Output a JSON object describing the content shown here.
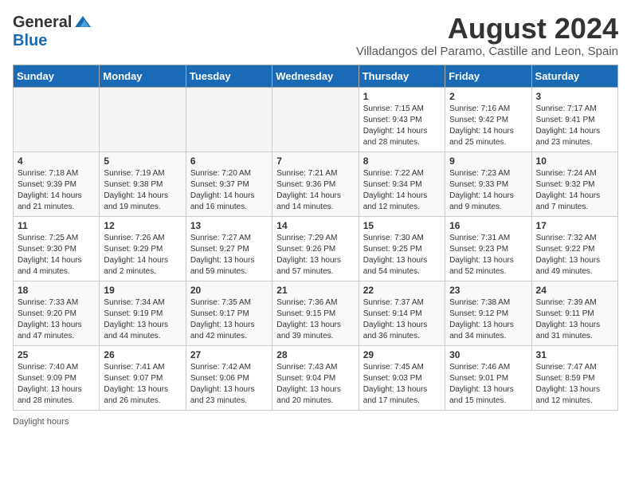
{
  "header": {
    "logo_general": "General",
    "logo_blue": "Blue",
    "month_title": "August 2024",
    "location": "Villadangos del Paramo, Castille and Leon, Spain"
  },
  "days_of_week": [
    "Sunday",
    "Monday",
    "Tuesday",
    "Wednesday",
    "Thursday",
    "Friday",
    "Saturday"
  ],
  "weeks": [
    [
      {
        "day": "",
        "empty": true
      },
      {
        "day": "",
        "empty": true
      },
      {
        "day": "",
        "empty": true
      },
      {
        "day": "",
        "empty": true
      },
      {
        "day": "1",
        "sunrise": "7:15 AM",
        "sunset": "9:43 PM",
        "daylight": "14 hours and 28 minutes."
      },
      {
        "day": "2",
        "sunrise": "7:16 AM",
        "sunset": "9:42 PM",
        "daylight": "14 hours and 25 minutes."
      },
      {
        "day": "3",
        "sunrise": "7:17 AM",
        "sunset": "9:41 PM",
        "daylight": "14 hours and 23 minutes."
      }
    ],
    [
      {
        "day": "4",
        "sunrise": "7:18 AM",
        "sunset": "9:39 PM",
        "daylight": "14 hours and 21 minutes."
      },
      {
        "day": "5",
        "sunrise": "7:19 AM",
        "sunset": "9:38 PM",
        "daylight": "14 hours and 19 minutes."
      },
      {
        "day": "6",
        "sunrise": "7:20 AM",
        "sunset": "9:37 PM",
        "daylight": "14 hours and 16 minutes."
      },
      {
        "day": "7",
        "sunrise": "7:21 AM",
        "sunset": "9:36 PM",
        "daylight": "14 hours and 14 minutes."
      },
      {
        "day": "8",
        "sunrise": "7:22 AM",
        "sunset": "9:34 PM",
        "daylight": "14 hours and 12 minutes."
      },
      {
        "day": "9",
        "sunrise": "7:23 AM",
        "sunset": "9:33 PM",
        "daylight": "14 hours and 9 minutes."
      },
      {
        "day": "10",
        "sunrise": "7:24 AM",
        "sunset": "9:32 PM",
        "daylight": "14 hours and 7 minutes."
      }
    ],
    [
      {
        "day": "11",
        "sunrise": "7:25 AM",
        "sunset": "9:30 PM",
        "daylight": "14 hours and 4 minutes."
      },
      {
        "day": "12",
        "sunrise": "7:26 AM",
        "sunset": "9:29 PM",
        "daylight": "14 hours and 2 minutes."
      },
      {
        "day": "13",
        "sunrise": "7:27 AM",
        "sunset": "9:27 PM",
        "daylight": "13 hours and 59 minutes."
      },
      {
        "day": "14",
        "sunrise": "7:29 AM",
        "sunset": "9:26 PM",
        "daylight": "13 hours and 57 minutes."
      },
      {
        "day": "15",
        "sunrise": "7:30 AM",
        "sunset": "9:25 PM",
        "daylight": "13 hours and 54 minutes."
      },
      {
        "day": "16",
        "sunrise": "7:31 AM",
        "sunset": "9:23 PM",
        "daylight": "13 hours and 52 minutes."
      },
      {
        "day": "17",
        "sunrise": "7:32 AM",
        "sunset": "9:22 PM",
        "daylight": "13 hours and 49 minutes."
      }
    ],
    [
      {
        "day": "18",
        "sunrise": "7:33 AM",
        "sunset": "9:20 PM",
        "daylight": "13 hours and 47 minutes."
      },
      {
        "day": "19",
        "sunrise": "7:34 AM",
        "sunset": "9:19 PM",
        "daylight": "13 hours and 44 minutes."
      },
      {
        "day": "20",
        "sunrise": "7:35 AM",
        "sunset": "9:17 PM",
        "daylight": "13 hours and 42 minutes."
      },
      {
        "day": "21",
        "sunrise": "7:36 AM",
        "sunset": "9:15 PM",
        "daylight": "13 hours and 39 minutes."
      },
      {
        "day": "22",
        "sunrise": "7:37 AM",
        "sunset": "9:14 PM",
        "daylight": "13 hours and 36 minutes."
      },
      {
        "day": "23",
        "sunrise": "7:38 AM",
        "sunset": "9:12 PM",
        "daylight": "13 hours and 34 minutes."
      },
      {
        "day": "24",
        "sunrise": "7:39 AM",
        "sunset": "9:11 PM",
        "daylight": "13 hours and 31 minutes."
      }
    ],
    [
      {
        "day": "25",
        "sunrise": "7:40 AM",
        "sunset": "9:09 PM",
        "daylight": "13 hours and 28 minutes."
      },
      {
        "day": "26",
        "sunrise": "7:41 AM",
        "sunset": "9:07 PM",
        "daylight": "13 hours and 26 minutes."
      },
      {
        "day": "27",
        "sunrise": "7:42 AM",
        "sunset": "9:06 PM",
        "daylight": "13 hours and 23 minutes."
      },
      {
        "day": "28",
        "sunrise": "7:43 AM",
        "sunset": "9:04 PM",
        "daylight": "13 hours and 20 minutes."
      },
      {
        "day": "29",
        "sunrise": "7:45 AM",
        "sunset": "9:03 PM",
        "daylight": "13 hours and 17 minutes."
      },
      {
        "day": "30",
        "sunrise": "7:46 AM",
        "sunset": "9:01 PM",
        "daylight": "13 hours and 15 minutes."
      },
      {
        "day": "31",
        "sunrise": "7:47 AM",
        "sunset": "8:59 PM",
        "daylight": "13 hours and 12 minutes."
      }
    ]
  ],
  "footer": {
    "note": "Daylight hours"
  }
}
